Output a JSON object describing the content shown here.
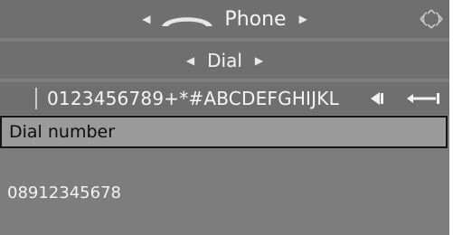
{
  "header": {
    "title": "Phone",
    "icon": "handset-icon",
    "corner_icon": "move-arrows-icon"
  },
  "submenu": {
    "label": "Dial"
  },
  "speller": {
    "characters": "0123456789+*#ABCDEFGHIJKL",
    "delete_icon": "delete-char-icon",
    "enter_icon": "enter-icon"
  },
  "field": {
    "label": "Dial number",
    "value": "08912345678"
  },
  "colors": {
    "background": "#7d7d7d",
    "bar": "#6f6f6f",
    "field": "#9a9a9a",
    "text_light": "#f4f4f4",
    "text_dark": "#0d0d0d"
  }
}
